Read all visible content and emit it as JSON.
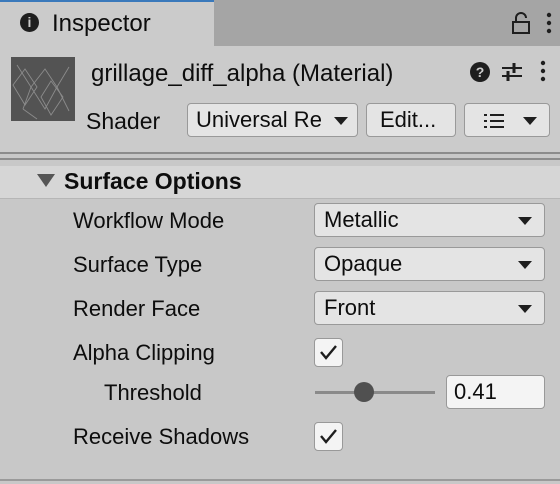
{
  "tab": {
    "title": "Inspector",
    "info_icon": "i"
  },
  "header": {
    "material_name": "grillage_diff_alpha (Material)",
    "shader_label": "Shader",
    "shader_value": "Universal Re",
    "edit_button": "Edit..."
  },
  "section": {
    "title": "Surface Options",
    "props": [
      {
        "label": "Workflow Mode",
        "value": "Metallic"
      },
      {
        "label": "Surface Type",
        "value": "Opaque"
      },
      {
        "label": "Render Face",
        "value": "Front"
      },
      {
        "label": "Alpha Clipping",
        "checked": true
      },
      {
        "label": "Threshold",
        "value": "0.41",
        "slider_fraction": 0.41
      },
      {
        "label": "Receive Shadows",
        "checked": true
      }
    ]
  },
  "colors": {
    "tab_accent": "#3a79bb",
    "panel_bg": "#c8c8c8",
    "tabbar_bg": "#a5a5a5",
    "field_bg": "#e4e4e4"
  },
  "icons": [
    "info-icon",
    "lock-icon",
    "kebab-menu-icon",
    "help-icon",
    "preset-sliders-icon",
    "list-icon",
    "chevron-down-icon",
    "foldout-triangle-icon",
    "checkmark-icon"
  ]
}
